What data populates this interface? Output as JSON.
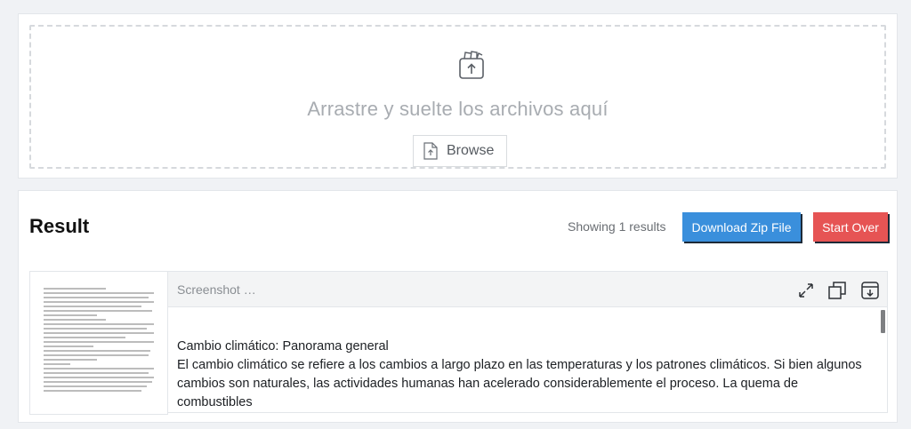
{
  "upload": {
    "drop_text": "Arrastre y suelte los archivos aquí",
    "browse_label": "Browse",
    "icons": {
      "upload": "upload-box-icon",
      "browse": "file-upload-icon"
    }
  },
  "result": {
    "title": "Result",
    "count_text": "Showing 1 results",
    "download_label": "Download Zip File",
    "start_over_label": "Start Over",
    "colors": {
      "download": "#3a8fdc",
      "start_over": "#e65454"
    },
    "preview": {
      "label": "Screenshot …",
      "icons": [
        "expand-icon",
        "copy-icon",
        "download-icon"
      ],
      "heading": "Cambio climático: Panorama general",
      "body": "El cambio climático se refiere a los cambios a largo plazo en las temperaturas y los patrones climáticos. Si bien algunos cambios son naturales, las actividades humanas han acelerado considerablemente el proceso. La quema de combustibles"
    }
  }
}
